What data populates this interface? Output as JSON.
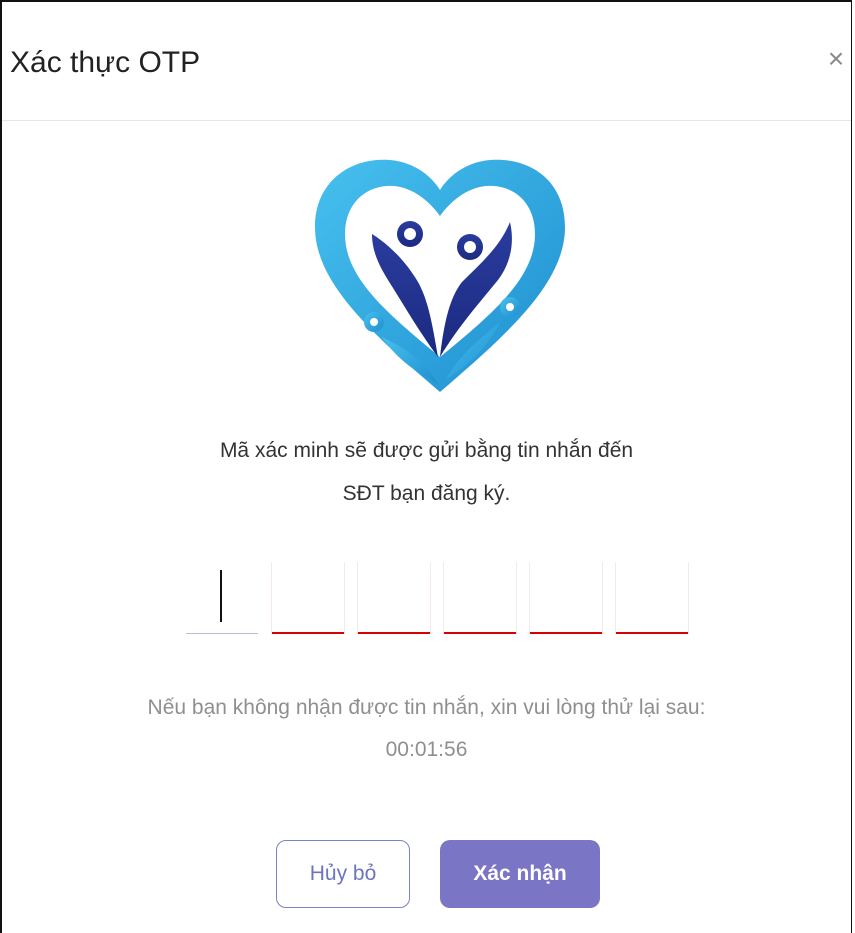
{
  "dialog": {
    "title": "Xác thực OTP",
    "close_symbol": "×",
    "logo_icon": "heart-family-logo",
    "message_line1": "Mã xác minh sẽ được gửi bằng tin nhắn đến",
    "message_line2": "SĐT bạn đăng ký.",
    "otp": {
      "digits": [
        "",
        "",
        "",
        "",
        "",
        ""
      ],
      "error_color": "#d90000"
    },
    "retry_line1": "Nếu bạn không nhận được tin nhắn, xin vui lòng thử lại sau:",
    "timer": "00:01:56",
    "cancel_label": "Hủy bỏ",
    "confirm_label": "Xác nhận",
    "colors": {
      "accent": "#7b75c6",
      "logo_light": "#2aa6df",
      "logo_dark": "#283a99"
    }
  }
}
